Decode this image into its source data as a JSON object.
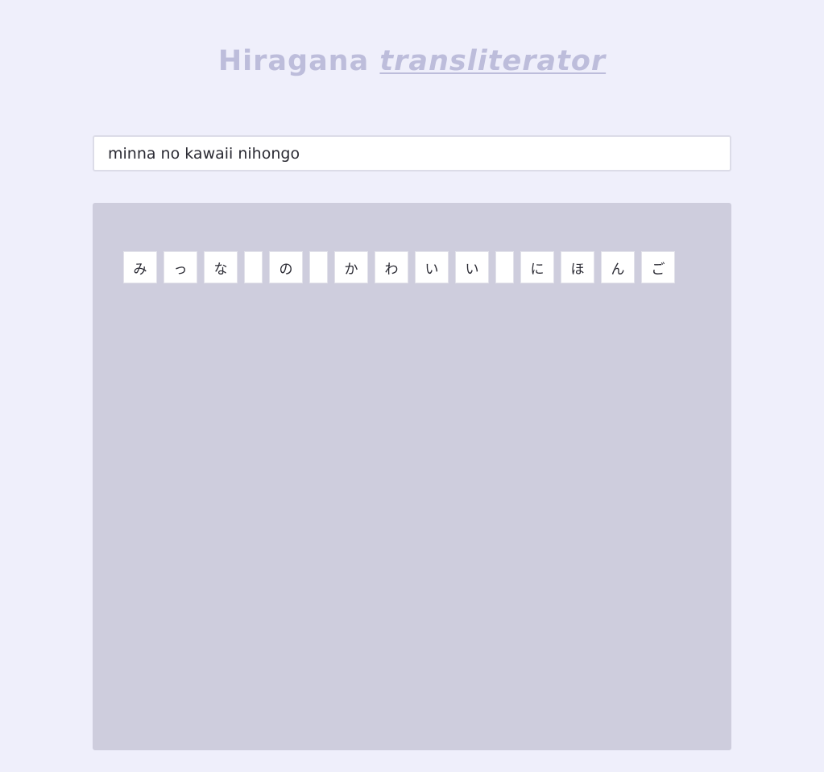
{
  "header": {
    "title_word": "Hiragana",
    "title_link": "transliterator"
  },
  "input": {
    "value": "minna no kawaii nihongo"
  },
  "output": {
    "tiles": [
      "み",
      "っ",
      "な",
      " ",
      "の",
      " ",
      "か",
      "わ",
      "い",
      "い",
      " ",
      "に",
      "ほ",
      "ん",
      "ご"
    ]
  }
}
